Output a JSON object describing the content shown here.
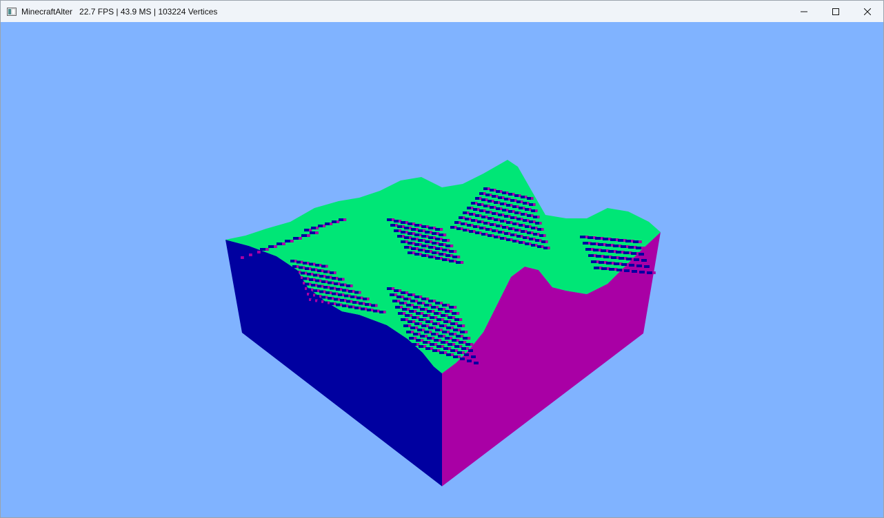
{
  "window": {
    "app_name": "MinecraftAlter",
    "stats": "22.7 FPS | 43.9 MS | 103224 Vertices",
    "controls": {
      "minimize": "minimize-icon",
      "maximize": "maximize-icon",
      "close": "close-icon"
    }
  },
  "scene": {
    "sky_color": "#80b3ff",
    "top_color": "#00e676",
    "left_face_color": "#0000a0",
    "right_face_color": "#a900a5"
  }
}
